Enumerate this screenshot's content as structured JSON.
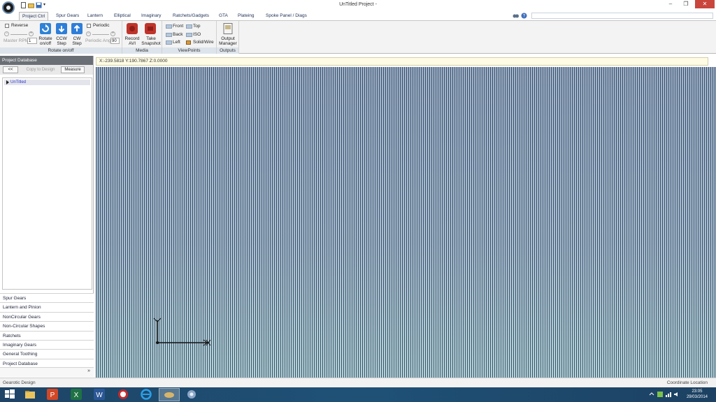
{
  "window": {
    "title": "UnTitled Project -"
  },
  "tabs": [
    "Project Ctrl",
    "Spur Gears",
    "Lantern",
    "Elliptical",
    "Imaginary",
    "Ratchets/Gadgets",
    "GTA",
    "Plateing",
    "Spoke Panel / Diags"
  ],
  "ribbon": {
    "rotate_group": {
      "reverse": "Reverse",
      "master_rpm": "Master RPM",
      "master_rpm_value": "1",
      "rotate_onoff": "Rotate on/off",
      "ccw_step": "CCW Step",
      "cw_step": "CW Step",
      "periodic": "Periodic",
      "periodic_ang": "Periodic Ang",
      "periodic_ang_value": "90",
      "label": "Rotate on/off"
    },
    "media_group": {
      "record_avi": "Record AVI",
      "take_snapshot": "Take Snapshot",
      "label": "Media"
    },
    "viewpoints_group": {
      "front": "Front",
      "top": "Top",
      "back": "Back",
      "iso": "ISO",
      "left": "Left",
      "solid_wire": "Solid/Wire",
      "label": "ViewPoints"
    },
    "outputs_group": {
      "output_manager": "Output Manager",
      "label": "Outputs"
    }
  },
  "left_panel": {
    "header": "Project Database",
    "back_button": "<<",
    "copy_to_design": "Copy to Design",
    "measure": "Measure",
    "tree_item": "UnTitled",
    "nav_items": [
      "Spur Gears",
      "Lantern and Pinion",
      "NonCircular Gears",
      "Non-Circular Shapes",
      "Ratchets",
      "Imaginary Gears",
      "General Toothing",
      "Project Database"
    ],
    "more_glyph": "»"
  },
  "coord_readout": "X:-239.5818 Y:190.7867 Z:0.0000",
  "status": {
    "left": "Gearotic Design",
    "right": "Coordinate Location"
  },
  "taskbar": {
    "time": "23:05",
    "date": "29/03/2014"
  },
  "colors": {
    "accent_blue": "#1f5177",
    "record_red": "#c0342b",
    "viewport_top": "#9fb2c8",
    "viewport_bottom": "#b3d3d6"
  }
}
